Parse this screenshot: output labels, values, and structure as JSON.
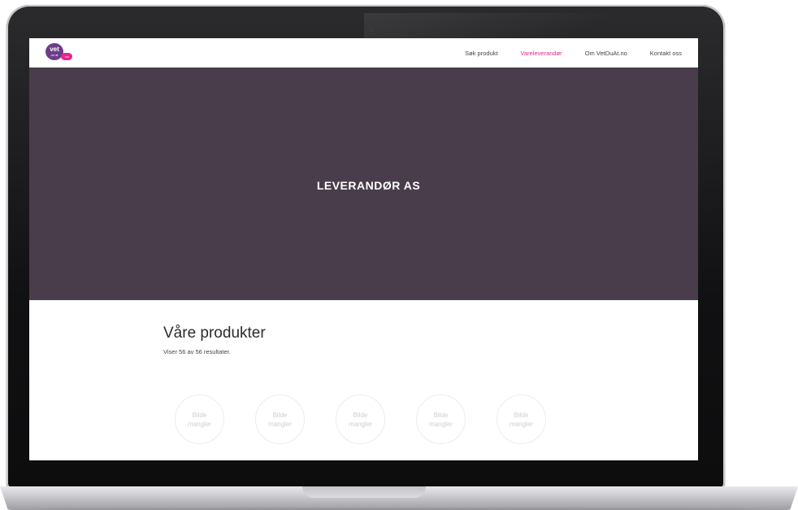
{
  "logo": {
    "word": "vet",
    "subline": "du at",
    "badge": ".no"
  },
  "nav": {
    "items": [
      {
        "label": "Søk produkt",
        "active": false
      },
      {
        "label": "Vareleverandør",
        "active": true
      },
      {
        "label": "Om VetDuAt.no",
        "active": false
      },
      {
        "label": "Kontakt oss",
        "active": false
      }
    ]
  },
  "hero": {
    "title": "LEVERANDØR AS"
  },
  "products": {
    "heading": "Våre produkter",
    "count_text": "Viser 56 av 56 resultater.",
    "placeholders": [
      {
        "line1": "Bilde",
        "line2": "mangler"
      },
      {
        "line1": "Bilde",
        "line2": "mangler"
      },
      {
        "line1": "Bilde",
        "line2": "mangler"
      },
      {
        "line1": "Bilde",
        "line2": "mangler"
      },
      {
        "line1": "Bilde",
        "line2": "mangler"
      }
    ]
  },
  "colors": {
    "brand_purple": "#6d3c89",
    "brand_pink": "#e7268f",
    "hero_background": "#4a3d4b",
    "header_background": "#ffffff"
  }
}
